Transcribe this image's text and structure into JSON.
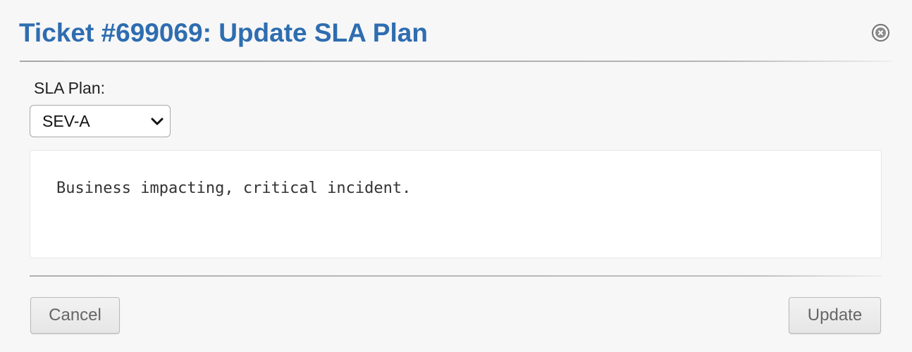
{
  "dialog": {
    "title": "Ticket #699069: Update SLA Plan",
    "close_icon": "close-circle-icon"
  },
  "form": {
    "sla_label": "SLA Plan:",
    "sla_selected": "SEV-A",
    "sla_chevron_icon": "chevron-down-icon",
    "description": "Business impacting, critical incident."
  },
  "actions": {
    "cancel_label": "Cancel",
    "update_label": "Update"
  },
  "colors": {
    "title": "#2e6db0",
    "background": "#f7f7f7",
    "panel": "#ffffff"
  }
}
